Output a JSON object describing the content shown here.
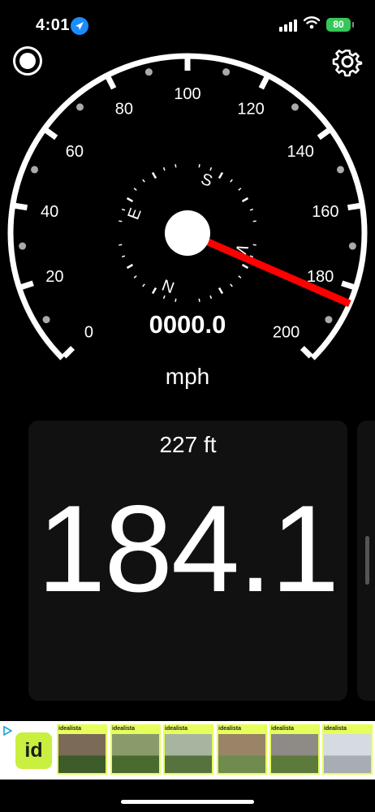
{
  "status_bar": {
    "time": "4:01",
    "battery": "80",
    "icons": [
      "location-arrow-icon",
      "cellular-signal-icon",
      "wifi-icon",
      "battery-charging-icon"
    ]
  },
  "toolbar": {
    "record_icon": "record-icon",
    "settings_icon": "gear-icon"
  },
  "speedometer": {
    "tick_labels": [
      "0",
      "20",
      "40",
      "60",
      "80",
      "100",
      "120",
      "140",
      "160",
      "180",
      "200"
    ],
    "max": 200,
    "needle_value": 184.1,
    "compass_letters": [
      "S",
      "W",
      "N",
      "E"
    ],
    "odometer": "0000.0",
    "unit": "mph",
    "colors": {
      "needle": "#ff0000",
      "compass_n": "#ff3b30"
    }
  },
  "card": {
    "altitude": "227 ft",
    "speed": "184.1"
  },
  "ad": {
    "logo_text": "id",
    "thumb_brand": "idealista",
    "thumbnails": [
      "property-photo",
      "property-photo",
      "property-photo",
      "property-photo",
      "property-photo",
      "property-photo"
    ]
  }
}
